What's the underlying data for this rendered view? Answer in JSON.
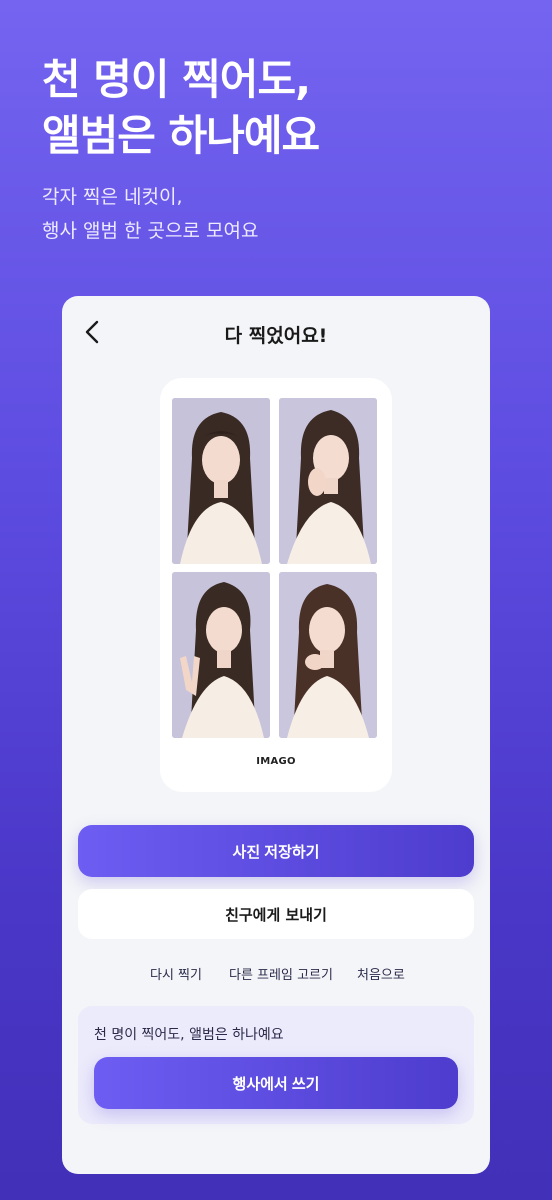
{
  "hero": {
    "title_line1": "천 명이 찍어도,",
    "title_line2": "앨범은 하나예요",
    "subtitle_line1": "각자 찍은 네컷이,",
    "subtitle_line2": "행사 앨범 한 곳으로 모여요"
  },
  "screen": {
    "back_icon": "chevron-left-icon",
    "title": "다 찍었어요!"
  },
  "photo_strip": {
    "brand": "IMAGO",
    "photos": [
      "photo-1",
      "photo-2",
      "photo-3",
      "photo-4"
    ]
  },
  "actions": {
    "save_label": "사진 저장하기",
    "send_label": "친구에게 보내기",
    "retake_label": "다시 찍기",
    "frame_label": "다른 프레임 고르기",
    "home_label": "처음으로"
  },
  "event": {
    "text": "천 명이 찍어도, 앨범은 하나예요",
    "button_label": "행사에서 쓰기"
  },
  "colors": {
    "accent": "#5d4ce0",
    "accent_dark": "#4230b8",
    "card_bg": "#f4f5f8"
  }
}
